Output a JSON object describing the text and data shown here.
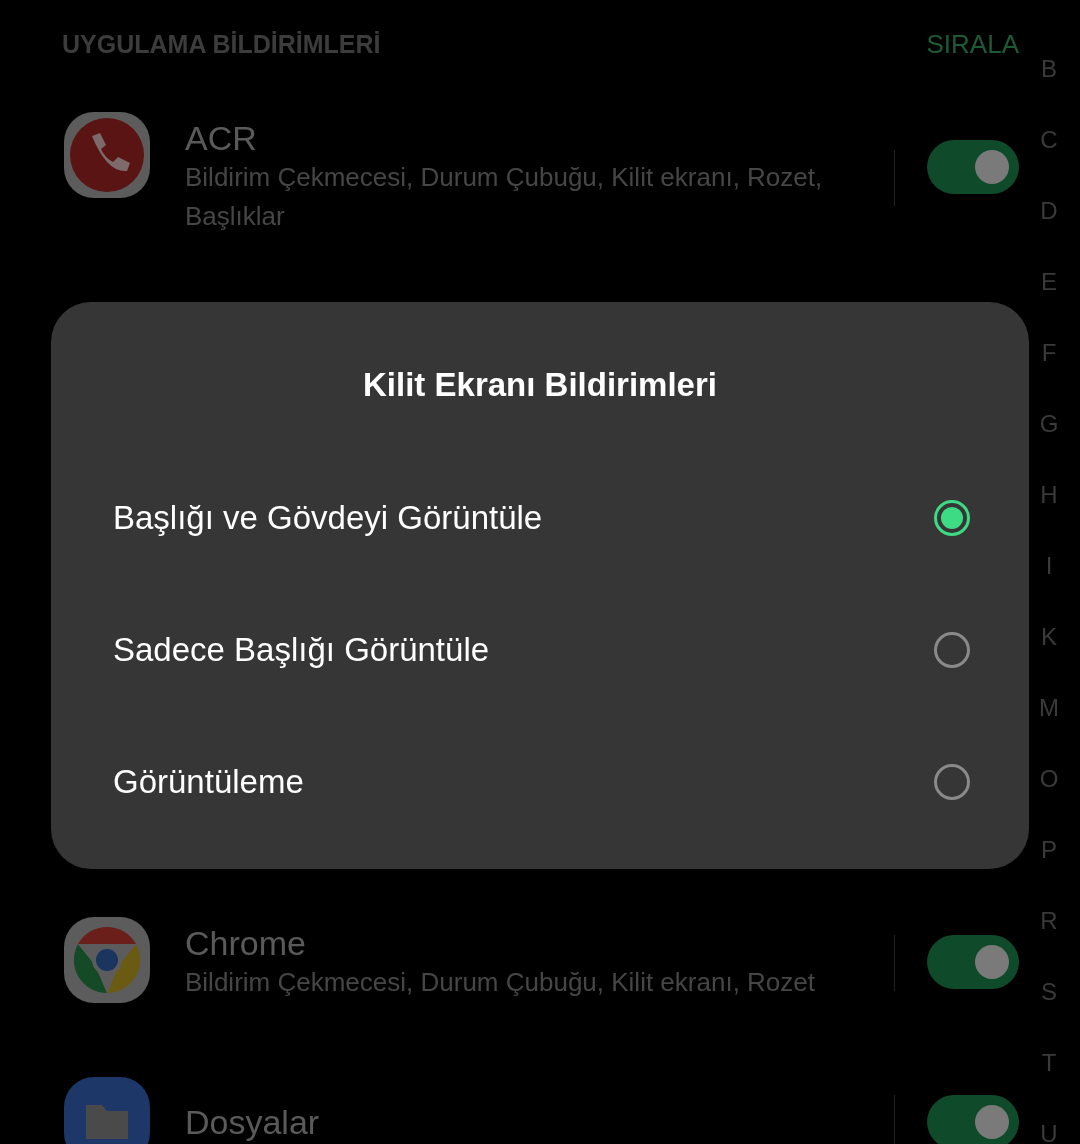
{
  "header": {
    "title": "UYGULAMA BİLDİRİMLERİ",
    "sort_button": "SIRALA"
  },
  "apps": [
    {
      "kind": "phone",
      "name": "ACR",
      "summary": "Bildirim Çekmecesi, Durum Çubuğu, Kilit ekranı, Rozet, Başlıklar",
      "on": true
    },
    {
      "kind": "chrome",
      "name": "Chrome",
      "summary": "Bildirim Çekmecesi, Durum Çubuğu, Kilit ekranı, Rozet",
      "on": true
    },
    {
      "kind": "folder",
      "name": "Dosyalar",
      "on": true
    }
  ],
  "index": [
    "B",
    "C",
    "D",
    "E",
    "F",
    "G",
    "H",
    "I",
    "K",
    "M",
    "O",
    "P",
    "R",
    "S",
    "T",
    "U"
  ],
  "dialog": {
    "title": "Kilit Ekranı Bildirimleri",
    "options": [
      {
        "label": "Başlığı ve Gövdeyi Görüntüle",
        "selected": true
      },
      {
        "label": "Sadece Başlığı Görüntüle",
        "selected": false
      },
      {
        "label": "Görüntüleme",
        "selected": false
      }
    ]
  }
}
